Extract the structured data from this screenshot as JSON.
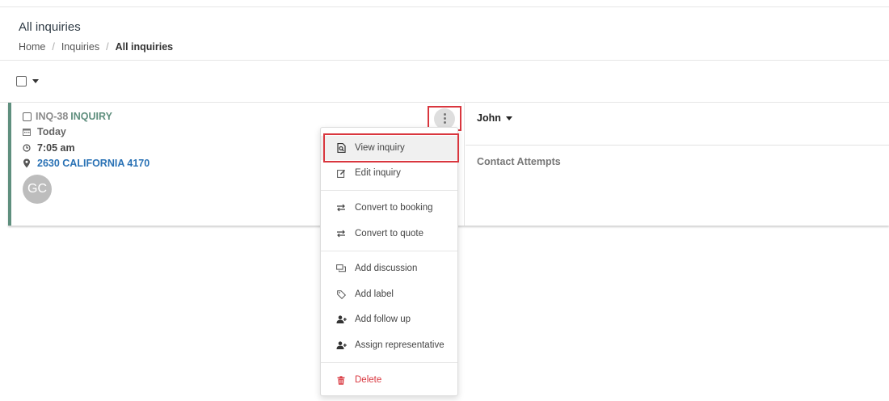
{
  "header": {
    "title": "All inquiries",
    "breadcrumb": [
      "Home",
      "Inquiries",
      "All inquiries"
    ],
    "separator": "/"
  },
  "inquiry": {
    "id": "INQ-38",
    "type": "INQUIRY",
    "date": "Today",
    "time": "7:05 am",
    "address": "2630 CALIFORNIA 4170",
    "avatar_initials": "GC",
    "representative": "John",
    "contact_attempts_label": "Contact Attempts"
  },
  "menu": {
    "items": [
      {
        "label": "View inquiry",
        "icon": "view-doc-icon"
      },
      {
        "label": "Edit inquiry",
        "icon": "edit-icon"
      },
      {
        "label": "Convert to booking",
        "icon": "swap-icon"
      },
      {
        "label": "Convert to quote",
        "icon": "swap-icon"
      },
      {
        "label": "Add discussion",
        "icon": "discussion-icon"
      },
      {
        "label": "Add label",
        "icon": "tag-icon"
      },
      {
        "label": "Add follow up",
        "icon": "user-plus-icon"
      },
      {
        "label": "Assign representative",
        "icon": "user-plus-icon"
      },
      {
        "label": "Delete",
        "icon": "trash-icon"
      }
    ]
  },
  "colors": {
    "accent_green": "#5f8f7e",
    "link_blue": "#2a72b5",
    "danger_red": "#d9363e"
  }
}
